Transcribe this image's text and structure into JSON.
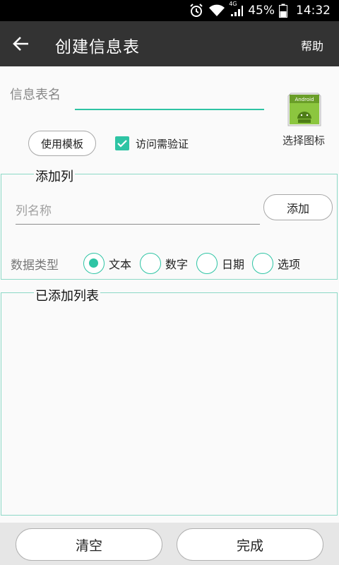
{
  "status_bar": {
    "network": "4G",
    "battery": "45%",
    "time": "14:32"
  },
  "app_bar": {
    "title": "创建信息表",
    "help_label": "帮助"
  },
  "form": {
    "name_label": "信息表名",
    "name_value": "",
    "template_button": "使用模板",
    "verify_checkbox": {
      "label": "访问需验证",
      "checked": true
    },
    "icon_caption": "选择图标",
    "icon_badge_text": "Android"
  },
  "add_column": {
    "title": "添加列",
    "name_placeholder": "列名称",
    "add_button": "添加",
    "type_label": "数据类型",
    "types": [
      {
        "label": "文本",
        "selected": true
      },
      {
        "label": "数字",
        "selected": false
      },
      {
        "label": "日期",
        "selected": false
      },
      {
        "label": "选项",
        "selected": false
      }
    ]
  },
  "added_columns": {
    "title": "已添加列表",
    "items": []
  },
  "bottom": {
    "clear_button": "清空",
    "done_button": "完成"
  },
  "colors": {
    "accent": "#2ec4a4",
    "app_bar": "#333333",
    "status_bar": "#000000"
  }
}
